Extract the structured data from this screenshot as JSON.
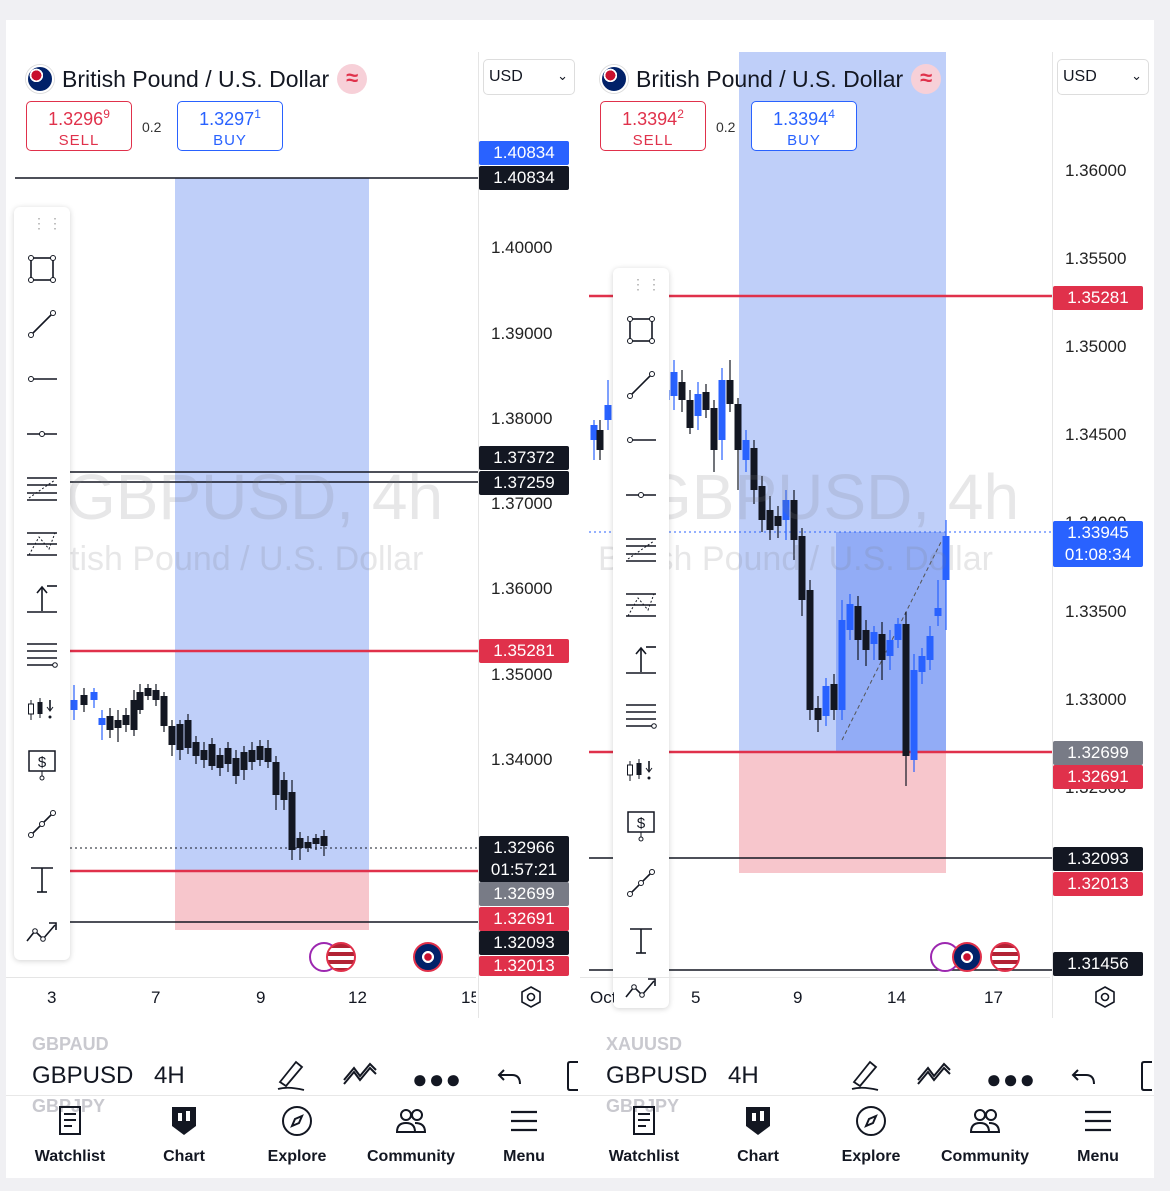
{
  "left": {
    "symbol_name": "British Pound / U.S. Dollar",
    "sell": {
      "main": "1.3296",
      "small": "9",
      "label": "SELL"
    },
    "buy": {
      "main": "1.3297",
      "small": "1",
      "label": "BUY"
    },
    "spread": "0.2",
    "currency": "USD",
    "watermark_big": "GBPUSD, 4h",
    "watermark_small": "tish Pound / U.S. Dollar",
    "price_ticks": [
      "1.40000",
      "1.39000",
      "1.38000",
      "1.37000",
      "1.36000",
      "1.35000",
      "1.34000"
    ],
    "labels": {
      "l1": "1.40834",
      "l2": "1.40834",
      "l3": "1.37372",
      "l4": "1.37259",
      "l5": "1.35281",
      "l6": "1.32966",
      "l6b": "01:57:21",
      "l7": "1.32699",
      "l8": "1.32691",
      "l9": "1.32093",
      "l10": "1.32013"
    },
    "x_ticks": [
      "3",
      "7",
      "9",
      "12",
      "15"
    ],
    "symbol_short": "GBPUSD",
    "timeframe": "4H",
    "ghost_above": "GBPAUD",
    "ghost_below": "GBPJPY"
  },
  "right": {
    "symbol_name": "British Pound / U.S. Dollar",
    "sell": {
      "main": "1.3394",
      "small": "2",
      "label": "SELL"
    },
    "buy": {
      "main": "1.3394",
      "small": "4",
      "label": "BUY"
    },
    "spread": "0.2",
    "currency": "USD",
    "watermark_big": "GBPUSD, 4h",
    "watermark_small": "British Pound / U.S. Dollar",
    "price_ticks": [
      "1.36000",
      "1.35500",
      "1.35000",
      "1.34500",
      "1.34000",
      "1.33500",
      "1.33000",
      "1.32500"
    ],
    "labels": {
      "r1": "1.35281",
      "r2": "1.33945",
      "r2b": "01:08:34",
      "r3": "1.32699",
      "r4": "1.32691",
      "r5": "1.32093",
      "r6": "1.32013",
      "r7": "1.31456"
    },
    "x_ticks": [
      "Oct",
      "5",
      "9",
      "14",
      "17"
    ],
    "symbol_short": "GBPUSD",
    "timeframe": "4H",
    "ghost_above": "XAUUSD",
    "ghost_below": "GBPJPY"
  },
  "tabs": [
    "Watchlist",
    "Chart",
    "Explore",
    "Community",
    "Menu"
  ],
  "colors": {
    "blue": "#2962ff",
    "red": "#e0314b",
    "black": "#131722",
    "grey": "#787b86",
    "zone_blue": "#bcccf9",
    "zone_red": "#f7c6cc"
  }
}
